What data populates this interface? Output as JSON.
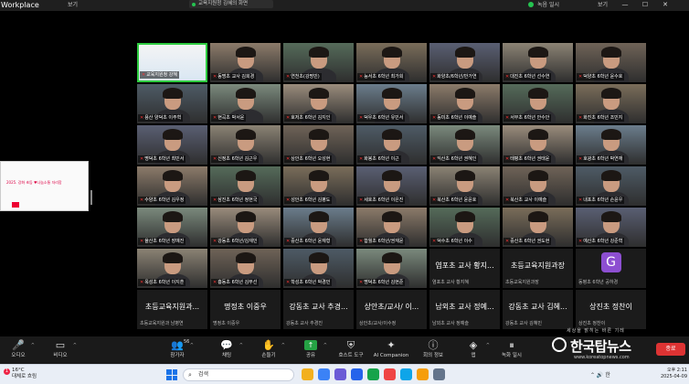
{
  "titlebar": {
    "app": "Workplace",
    "view_label": "보기",
    "share_chip": "교육지원청 김혜의 화면",
    "right_label_1": "녹음 일시",
    "right_label_2": "보기",
    "minimize": "—",
    "maximize": "☐",
    "close": "✕"
  },
  "shared_screen": {
    "title_text": "2025. 강화 초등 ♥나눔소통 자리함"
  },
  "participants": [
    {
      "name": "교육지원청 강혜",
      "style": "slide",
      "active": true
    },
    {
      "name": "동명초 교사 김희경",
      "style": "person"
    },
    {
      "name": "연천초(강명빈)",
      "style": "person"
    },
    {
      "name": "능서초 6학년 최가희",
      "style": "person"
    },
    {
      "name": "화양초/6학년/반가연",
      "style": "person"
    },
    {
      "name": "대진초 6학년 선수연",
      "style": "person"
    },
    {
      "name": "덕양초 6학년 윤수호",
      "style": "person"
    },
    {
      "name": "용산 양덕초 이주혁",
      "style": "person"
    },
    {
      "name": "현곡초 박서윤",
      "style": "person"
    },
    {
      "name": "호저초 6학년 김지인",
      "style": "person"
    },
    {
      "name": "덕우초 6학년 유민서",
      "style": "person"
    },
    {
      "name": "동미초 6학년 이예솔",
      "style": "person"
    },
    {
      "name": "서부초 6학년 안수안",
      "style": "person"
    },
    {
      "name": "화진초 6학년 조민지",
      "style": "person"
    },
    {
      "name": "명덕초 6학년 최민서",
      "style": "person"
    },
    {
      "name": "신정초 6학년 김근우",
      "style": "person"
    },
    {
      "name": "상안초 6학년 오성현",
      "style": "person"
    },
    {
      "name": "화봉초 6학년 이근",
      "style": "person"
    },
    {
      "name": "익산초 6학년 권혜인",
      "style": "person"
    },
    {
      "name": "태평초 6학년 권태윤",
      "style": "person"
    },
    {
      "name": "호광초 6학년 박연재",
      "style": "person"
    },
    {
      "name": "수양초 6학년 김우정",
      "style": "person"
    },
    {
      "name": "삼진초 6학년 정현국",
      "style": "person"
    },
    {
      "name": "성안초 6학년 김평도",
      "style": "person"
    },
    {
      "name": "세호초 6학년 이은진",
      "style": "person"
    },
    {
      "name": "북산초 6학년 윤윤호",
      "style": "person"
    },
    {
      "name": "북산초 교사 이예슬",
      "style": "person"
    },
    {
      "name": "내포초 6학년 손윤우",
      "style": "person"
    },
    {
      "name": "율산초 6학년 장예진",
      "style": "person"
    },
    {
      "name": "강동초 6학년/김재민",
      "style": "person"
    },
    {
      "name": "중산초 6학년 윤재형",
      "style": "person"
    },
    {
      "name": "합월초 6학년/권재윤",
      "style": "person"
    },
    {
      "name": "덕수초 6학년 이수",
      "style": "person"
    },
    {
      "name": "중산초 6학년 권도현",
      "style": "person"
    },
    {
      "name": "예산초 6학년 강준혁",
      "style": "person"
    },
    {
      "name": "옥성초 6학년 이지훈",
      "style": "person"
    },
    {
      "name": "흥동초 6학년 김부선",
      "style": "person"
    },
    {
      "name": "학성초 6학년 박경민",
      "style": "person"
    },
    {
      "name": "명덕초 6학년 김현준",
      "style": "person"
    },
    {
      "big": "염포초 교사 황지...",
      "name": "염포초 교사 황지혜",
      "style": "text"
    },
    {
      "big": "초등교육지원과장",
      "name": "초등교육지원과장",
      "style": "text"
    },
    {
      "big": "G",
      "name": "동평초 6학년 공하경",
      "style": "avatar"
    },
    {
      "big": "초등교육지원과...",
      "name": "초등교육지원과 남병연",
      "style": "text"
    },
    {
      "big": "명정초 이중우",
      "name": "명정초 이중우",
      "style": "text"
    },
    {
      "big": "강동초 교사 추경...",
      "name": "강동초 교사 추경진",
      "style": "text"
    },
    {
      "big": "상안초/교사/ 이...",
      "name": "상안초/교사/이수정",
      "style": "text"
    },
    {
      "big": "남외초 교사 정예...",
      "name": "남외초 교사 정예슬",
      "style": "text"
    },
    {
      "big": "강동초 교사 김혜...",
      "name": "강동초 교사 김혜민",
      "style": "text"
    },
    {
      "big": "상진초 정찬이",
      "name": "상진초 정찬이",
      "style": "text"
    }
  ],
  "toolbar": {
    "audio": "오디오",
    "video": "비디오",
    "participants": "참가자",
    "participants_count": "56",
    "chat": "채팅",
    "raise_hand": "손들기",
    "share": "공유",
    "host_tools": "호스트 도구",
    "ai_companion": "AI Companion",
    "meeting_info": "회의 정보",
    "apps": "앱",
    "record": "녹화 일시",
    "leave": "종료"
  },
  "watermark": {
    "tag": "세상을 밝히는 바른 기레",
    "brand": "한국탑뉴스",
    "url": "www.koreatopnews.com"
  },
  "taskbar": {
    "temp": "16°C",
    "condition": "대체로 흐림",
    "alert_badge": "1",
    "search_placeholder": "검색",
    "time": "오후 2:11",
    "date": "2025-04-09",
    "ime": "한"
  },
  "colors": {
    "active_border": "#2ecc40",
    "mute_red": "#e33333",
    "share_green": "#25a244",
    "avatar_purple": "#8d4fd1"
  }
}
